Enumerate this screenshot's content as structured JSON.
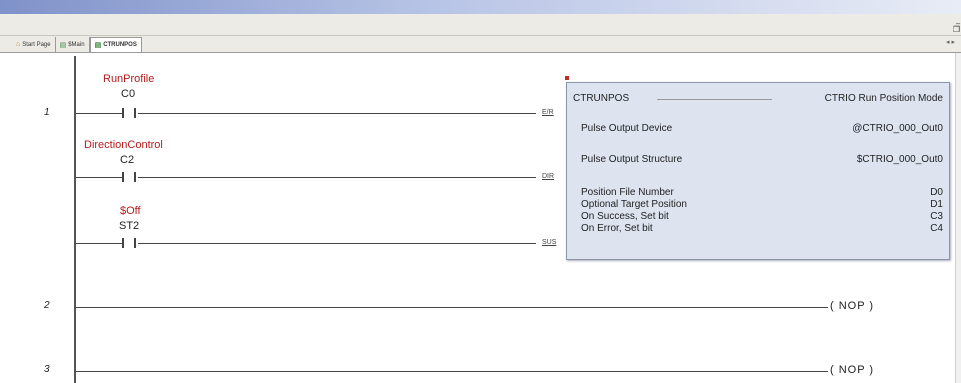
{
  "window": {
    "controls": [
      "_",
      "❐",
      "✕"
    ]
  },
  "tabs": [
    {
      "label": "Start Page",
      "icon": "home-icon"
    },
    {
      "label": "$Main",
      "icon": "ladder-icon"
    },
    {
      "label": "CTRUNPOS",
      "icon": "ladder-icon",
      "active": true
    }
  ],
  "tab_scroll": "◂ ▸",
  "rungs": [
    {
      "number": "1",
      "contacts": [
        {
          "nickname": "RunProfile",
          "address": "C0",
          "pin": "E/R"
        },
        {
          "nickname": "DirectionControl",
          "address": "C2",
          "pin": "DIR"
        },
        {
          "nickname": "$Off",
          "address": "ST2",
          "pin": "SUS"
        }
      ]
    },
    {
      "number": "2",
      "output": "( NOP )"
    },
    {
      "number": "3",
      "output": "( NOP )"
    }
  ],
  "instruction_box": {
    "name": "CTRUNPOS",
    "description": "CTRIO Run Position Mode",
    "params": [
      {
        "label": "Pulse Output Device",
        "value": "@CTRIO_000_Out0"
      },
      {
        "label": "Pulse Output Structure",
        "value": "$CTRIO_000_Out0"
      },
      {
        "label": "Position File Number",
        "value": "D0"
      },
      {
        "label": "Optional Target Position",
        "value": "D1"
      },
      {
        "label": "On Success, Set bit",
        "value": "C3"
      },
      {
        "label": "On Error, Set bit",
        "value": "C4"
      }
    ]
  },
  "colors": {
    "nickname": "#b41c1c",
    "instruction_box_bg": "#dde4f0",
    "titlebar": "#7f92c9"
  }
}
